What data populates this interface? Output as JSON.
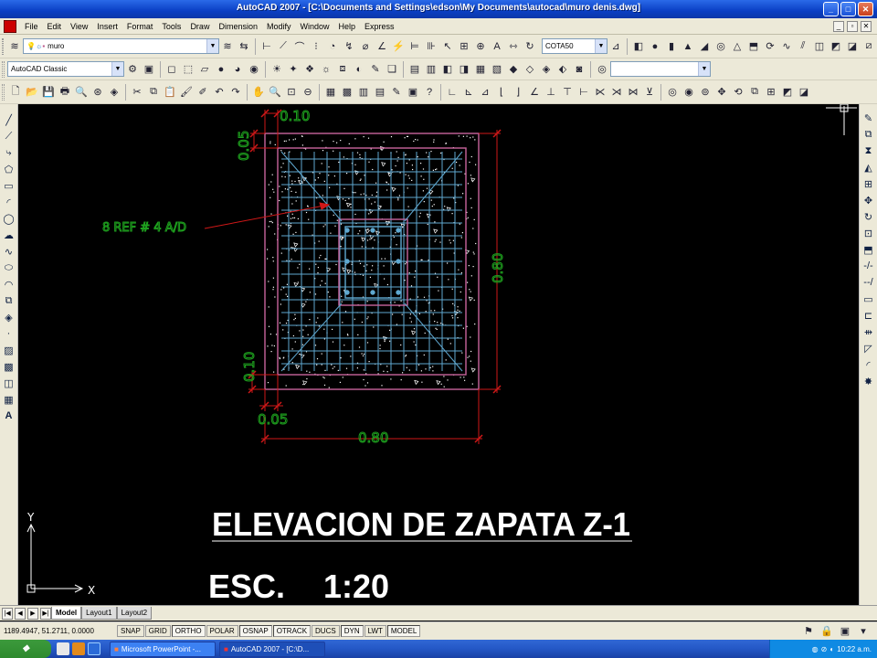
{
  "window": {
    "title": "AutoCAD 2007 - [C:\\Documents and Settings\\edson\\My Documents\\autocad\\muro denis.dwg]",
    "buttons": [
      "minimize-icon",
      "maximize-icon",
      "close-icon"
    ]
  },
  "menu": [
    "File",
    "Edit",
    "View",
    "Insert",
    "Format",
    "Tools",
    "Draw",
    "Dimension",
    "Modify",
    "Window",
    "Help",
    "Express"
  ],
  "toolbars": {
    "layer_value": "muro",
    "workspace_value": "AutoCAD Classic",
    "dimstyle_value": "COTA50"
  },
  "drawing": {
    "title": "ELEVACION DE ZAPATA Z-1",
    "scale_label": "ESC.",
    "scale_value": "1:20",
    "annotation": "8 REF # 4 A/D",
    "dims": {
      "top_left_offset": "0.10",
      "left_top_vertical": "0.05",
      "right_height": "0.80",
      "left_lower_vertical": "0.10",
      "bottom_offset": "0.05",
      "bottom_width": "0.80"
    },
    "ucs": {
      "x_label": "X",
      "y_label": "Y"
    },
    "colors": {
      "concrete_outline": "#c8649c",
      "rebar": "#5fa8d0",
      "dimension": "#d01818",
      "dim_text": "#1ea01e",
      "hatch": "#ffffff",
      "title_text": "#ffffff"
    }
  },
  "tabs": [
    "Model",
    "Layout1",
    "Layout2"
  ],
  "status": {
    "coords": "1189.4947, 51.2711, 0.0000",
    "toggles": [
      "SNAP",
      "GRID",
      "ORTHO",
      "POLAR",
      "OSNAP",
      "OTRACK",
      "DUCS",
      "DYN",
      "LWT",
      "MODEL"
    ]
  },
  "taskbar": {
    "tasks": [
      "Microsoft PowerPoint -...",
      "AutoCAD 2007 - [C:\\D..."
    ],
    "time": "10:22 a.m."
  }
}
